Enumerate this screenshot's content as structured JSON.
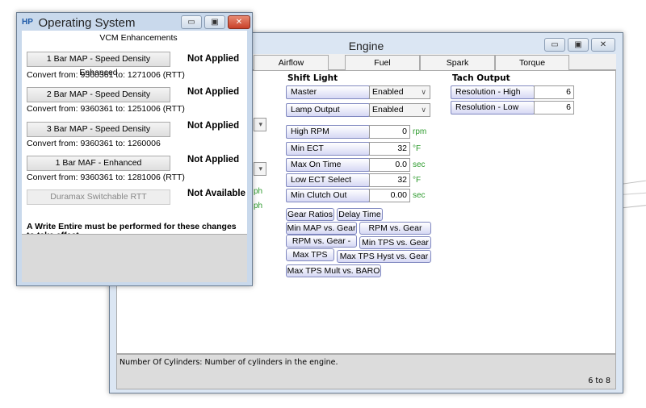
{
  "engine_window": {
    "title": "Engine",
    "tabs": [
      "Airflow",
      "Fuel",
      "Spark",
      "Torque Management"
    ],
    "shift_light": {
      "heading": "Shift Light",
      "selects": [
        {
          "label": "Master",
          "value": "Enabled"
        },
        {
          "label": "Lamp Output",
          "value": "Enabled"
        }
      ],
      "fields": [
        {
          "label": "High RPM",
          "value": "0",
          "unit": "rpm"
        },
        {
          "label": "Min ECT",
          "value": "32",
          "unit": "°F"
        },
        {
          "label": "Max On Time",
          "value": "0.0",
          "unit": "sec"
        },
        {
          "label": "Low ECT Select",
          "value": "32",
          "unit": "°F"
        },
        {
          "label": "Min Clutch Out",
          "value": "0.00",
          "unit": "sec"
        }
      ],
      "buttons": [
        "Gear Ratios",
        "Delay Time",
        "Min MAP vs. Gear",
        "RPM vs. Gear",
        "RPM vs. Gear -",
        "Min TPS vs. Gear",
        "Max TPS",
        "Max TPS Hyst vs. Gear",
        "Max TPS Mult vs. BARO"
      ]
    },
    "tach_output": {
      "heading": "Tach Output",
      "fields": [
        {
          "label": "Resolution - High",
          "value": "6"
        },
        {
          "label": "Resolution - Low",
          "value": "6"
        }
      ]
    },
    "partial_units": [
      "ph",
      "ph"
    ],
    "status": {
      "description": "Number Of Cylinders: Number of cylinders in the engine.",
      "range": "6 to 8"
    }
  },
  "os_window": {
    "logo": "HP",
    "title": "Operating System",
    "section": "VCM Enhancements",
    "items": [
      {
        "button": "1 Bar MAP - Speed Density Enhanced",
        "status": "Not Applied",
        "convert": "Convert from: 9360361 to: 1271006 (RTT)",
        "enabled": true
      },
      {
        "button": "2 Bar MAP - Speed Density",
        "status": "Not Applied",
        "convert": "Convert from: 9360361 to: 1251006 (RTT)",
        "enabled": true
      },
      {
        "button": "3 Bar MAP - Speed Density",
        "status": "Not Applied",
        "convert": "Convert from: 9360361 to: 1260006",
        "enabled": true
      },
      {
        "button": "1 Bar MAF - Enhanced",
        "status": "Not Applied",
        "convert": "Convert from: 9360361 to: 1281006 (RTT)",
        "enabled": true
      },
      {
        "button": "Duramax Switchable RTT",
        "status": "Not Available",
        "enabled": false
      }
    ],
    "note": "A Write Entire must be performed for these changes to take effect."
  }
}
